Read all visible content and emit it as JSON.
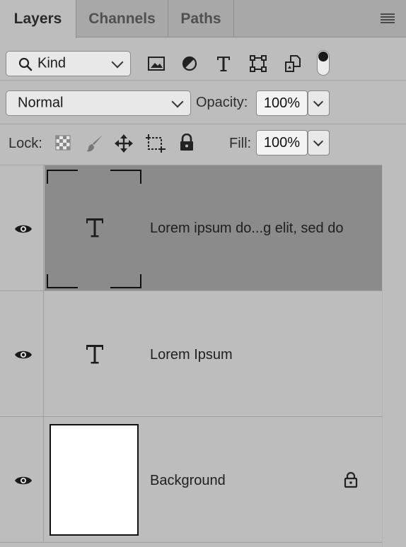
{
  "tabs": [
    {
      "label": "Layers",
      "active": true
    },
    {
      "label": "Channels",
      "active": false
    },
    {
      "label": "Paths",
      "active": false
    }
  ],
  "filter": {
    "kind_label": "Kind",
    "icons": [
      "image-filter-icon",
      "adjustment-filter-icon",
      "type-filter-icon",
      "shape-filter-icon",
      "smart-object-filter-icon",
      "filter-toggle"
    ]
  },
  "blend": {
    "mode": "Normal",
    "opacity_label": "Opacity:",
    "opacity_value": "100%"
  },
  "lock": {
    "label": "Lock:",
    "fill_label": "Fill:",
    "fill_value": "100%"
  },
  "layers": [
    {
      "name": "Lorem ipsum do...g elit, sed do",
      "type": "text",
      "selected": true,
      "visible": true,
      "locked": false
    },
    {
      "name": "Lorem Ipsum",
      "type": "text",
      "selected": false,
      "visible": true,
      "locked": false
    },
    {
      "name": "Background",
      "type": "image",
      "selected": false,
      "visible": true,
      "locked": true
    }
  ],
  "colors": {
    "panel": "#bdbdbd",
    "tabbar": "#a8a8a8",
    "selected_layer": "#8b8b8b"
  }
}
